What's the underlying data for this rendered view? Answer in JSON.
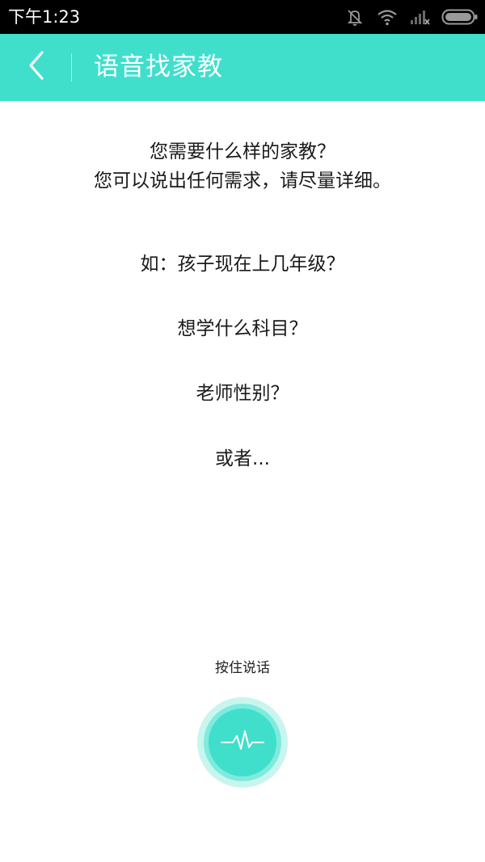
{
  "status_bar": {
    "time": "下午1:23",
    "icons": [
      "mute-icon",
      "wifi-icon",
      "signal-icon",
      "battery-icon"
    ]
  },
  "header": {
    "title": "语音找家教",
    "back_icon": "chevron-left-icon",
    "background_color": "#3fdfcc"
  },
  "prompt": {
    "line1": "您需要什么样的家教？",
    "line2": "您可以说出任何需求，请尽量详细。"
  },
  "examples": [
    "如：孩子现在上几年级？",
    "想学什么科目？",
    "老师性别？",
    "或者..."
  ],
  "voice": {
    "hold_label": "按住说话",
    "icon": "waveform-icon",
    "accent_color": "#3fdfcc"
  }
}
